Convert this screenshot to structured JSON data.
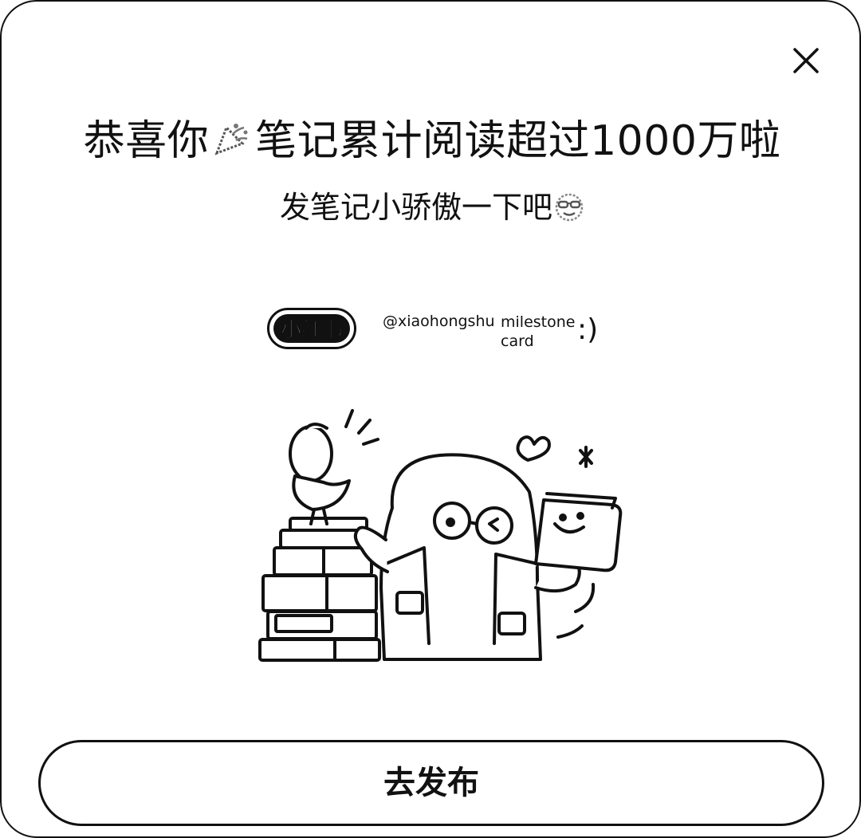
{
  "dialog": {
    "title_before": "恭喜你",
    "title_after": "笔记累计阅读超过1000万啦",
    "title_emoji": "party-popper-icon",
    "subtitle": "发笔记小骄傲一下吧",
    "subtitle_emoji": "sunglasses-face-icon",
    "close_icon": "close-icon"
  },
  "card": {
    "logo_text": "小红书",
    "handle": "@xiaohongshu",
    "milestone_line1": "milestone",
    "milestone_line2": "card",
    "smiley": ":)"
  },
  "illustration": {
    "subject": "milestone-illustration"
  },
  "action": {
    "publish_label": "去发布"
  },
  "colors": {
    "ink": "#111111",
    "background": "#ffffff"
  }
}
